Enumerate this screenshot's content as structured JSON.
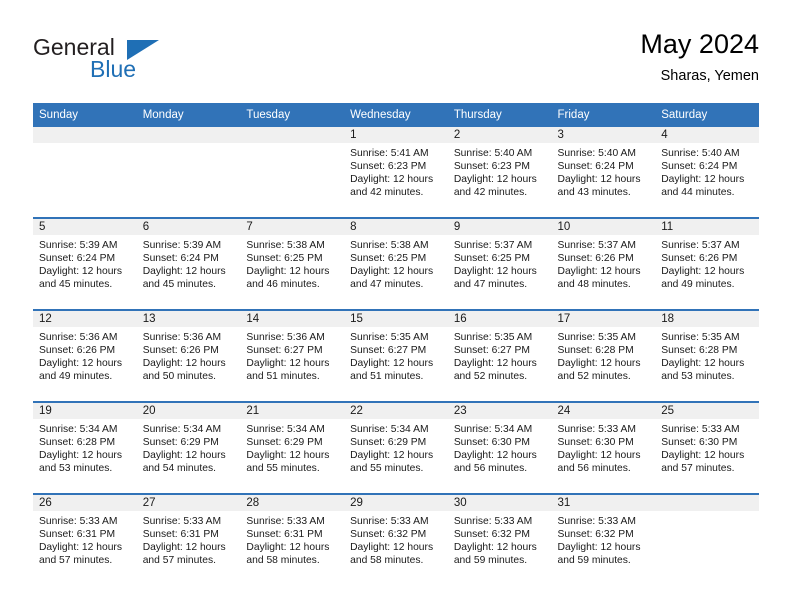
{
  "brand": {
    "name_part1": "General",
    "name_part2": "Blue",
    "accent_color": "#1f6fb5"
  },
  "header": {
    "title": "May 2024",
    "subtitle": "Sharas, Yemen"
  },
  "theme": {
    "header_row_background": "#3173b8",
    "daynum_background": "#f0f0f0",
    "week_separator": "#3173b8",
    "text_color": "#1a1a1a"
  },
  "calendar": {
    "weekday_headers": [
      "Sunday",
      "Monday",
      "Tuesday",
      "Wednesday",
      "Thursday",
      "Friday",
      "Saturday"
    ],
    "weeks": [
      [
        {
          "day": "",
          "empty": true
        },
        {
          "day": "",
          "empty": true
        },
        {
          "day": "",
          "empty": true
        },
        {
          "day": "1",
          "sunrise": "Sunrise: 5:41 AM",
          "sunset": "Sunset: 6:23 PM",
          "daylight": "Daylight: 12 hours and 42 minutes."
        },
        {
          "day": "2",
          "sunrise": "Sunrise: 5:40 AM",
          "sunset": "Sunset: 6:23 PM",
          "daylight": "Daylight: 12 hours and 42 minutes."
        },
        {
          "day": "3",
          "sunrise": "Sunrise: 5:40 AM",
          "sunset": "Sunset: 6:24 PM",
          "daylight": "Daylight: 12 hours and 43 minutes."
        },
        {
          "day": "4",
          "sunrise": "Sunrise: 5:40 AM",
          "sunset": "Sunset: 6:24 PM",
          "daylight": "Daylight: 12 hours and 44 minutes."
        }
      ],
      [
        {
          "day": "5",
          "sunrise": "Sunrise: 5:39 AM",
          "sunset": "Sunset: 6:24 PM",
          "daylight": "Daylight: 12 hours and 45 minutes."
        },
        {
          "day": "6",
          "sunrise": "Sunrise: 5:39 AM",
          "sunset": "Sunset: 6:24 PM",
          "daylight": "Daylight: 12 hours and 45 minutes."
        },
        {
          "day": "7",
          "sunrise": "Sunrise: 5:38 AM",
          "sunset": "Sunset: 6:25 PM",
          "daylight": "Daylight: 12 hours and 46 minutes."
        },
        {
          "day": "8",
          "sunrise": "Sunrise: 5:38 AM",
          "sunset": "Sunset: 6:25 PM",
          "daylight": "Daylight: 12 hours and 47 minutes."
        },
        {
          "day": "9",
          "sunrise": "Sunrise: 5:37 AM",
          "sunset": "Sunset: 6:25 PM",
          "daylight": "Daylight: 12 hours and 47 minutes."
        },
        {
          "day": "10",
          "sunrise": "Sunrise: 5:37 AM",
          "sunset": "Sunset: 6:26 PM",
          "daylight": "Daylight: 12 hours and 48 minutes."
        },
        {
          "day": "11",
          "sunrise": "Sunrise: 5:37 AM",
          "sunset": "Sunset: 6:26 PM",
          "daylight": "Daylight: 12 hours and 49 minutes."
        }
      ],
      [
        {
          "day": "12",
          "sunrise": "Sunrise: 5:36 AM",
          "sunset": "Sunset: 6:26 PM",
          "daylight": "Daylight: 12 hours and 49 minutes."
        },
        {
          "day": "13",
          "sunrise": "Sunrise: 5:36 AM",
          "sunset": "Sunset: 6:26 PM",
          "daylight": "Daylight: 12 hours and 50 minutes."
        },
        {
          "day": "14",
          "sunrise": "Sunrise: 5:36 AM",
          "sunset": "Sunset: 6:27 PM",
          "daylight": "Daylight: 12 hours and 51 minutes."
        },
        {
          "day": "15",
          "sunrise": "Sunrise: 5:35 AM",
          "sunset": "Sunset: 6:27 PM",
          "daylight": "Daylight: 12 hours and 51 minutes."
        },
        {
          "day": "16",
          "sunrise": "Sunrise: 5:35 AM",
          "sunset": "Sunset: 6:27 PM",
          "daylight": "Daylight: 12 hours and 52 minutes."
        },
        {
          "day": "17",
          "sunrise": "Sunrise: 5:35 AM",
          "sunset": "Sunset: 6:28 PM",
          "daylight": "Daylight: 12 hours and 52 minutes."
        },
        {
          "day": "18",
          "sunrise": "Sunrise: 5:35 AM",
          "sunset": "Sunset: 6:28 PM",
          "daylight": "Daylight: 12 hours and 53 minutes."
        }
      ],
      [
        {
          "day": "19",
          "sunrise": "Sunrise: 5:34 AM",
          "sunset": "Sunset: 6:28 PM",
          "daylight": "Daylight: 12 hours and 53 minutes."
        },
        {
          "day": "20",
          "sunrise": "Sunrise: 5:34 AM",
          "sunset": "Sunset: 6:29 PM",
          "daylight": "Daylight: 12 hours and 54 minutes."
        },
        {
          "day": "21",
          "sunrise": "Sunrise: 5:34 AM",
          "sunset": "Sunset: 6:29 PM",
          "daylight": "Daylight: 12 hours and 55 minutes."
        },
        {
          "day": "22",
          "sunrise": "Sunrise: 5:34 AM",
          "sunset": "Sunset: 6:29 PM",
          "daylight": "Daylight: 12 hours and 55 minutes."
        },
        {
          "day": "23",
          "sunrise": "Sunrise: 5:34 AM",
          "sunset": "Sunset: 6:30 PM",
          "daylight": "Daylight: 12 hours and 56 minutes."
        },
        {
          "day": "24",
          "sunrise": "Sunrise: 5:33 AM",
          "sunset": "Sunset: 6:30 PM",
          "daylight": "Daylight: 12 hours and 56 minutes."
        },
        {
          "day": "25",
          "sunrise": "Sunrise: 5:33 AM",
          "sunset": "Sunset: 6:30 PM",
          "daylight": "Daylight: 12 hours and 57 minutes."
        }
      ],
      [
        {
          "day": "26",
          "sunrise": "Sunrise: 5:33 AM",
          "sunset": "Sunset: 6:31 PM",
          "daylight": "Daylight: 12 hours and 57 minutes."
        },
        {
          "day": "27",
          "sunrise": "Sunrise: 5:33 AM",
          "sunset": "Sunset: 6:31 PM",
          "daylight": "Daylight: 12 hours and 57 minutes."
        },
        {
          "day": "28",
          "sunrise": "Sunrise: 5:33 AM",
          "sunset": "Sunset: 6:31 PM",
          "daylight": "Daylight: 12 hours and 58 minutes."
        },
        {
          "day": "29",
          "sunrise": "Sunrise: 5:33 AM",
          "sunset": "Sunset: 6:32 PM",
          "daylight": "Daylight: 12 hours and 58 minutes."
        },
        {
          "day": "30",
          "sunrise": "Sunrise: 5:33 AM",
          "sunset": "Sunset: 6:32 PM",
          "daylight": "Daylight: 12 hours and 59 minutes."
        },
        {
          "day": "31",
          "sunrise": "Sunrise: 5:33 AM",
          "sunset": "Sunset: 6:32 PM",
          "daylight": "Daylight: 12 hours and 59 minutes."
        },
        {
          "day": "",
          "empty": true
        }
      ]
    ]
  }
}
